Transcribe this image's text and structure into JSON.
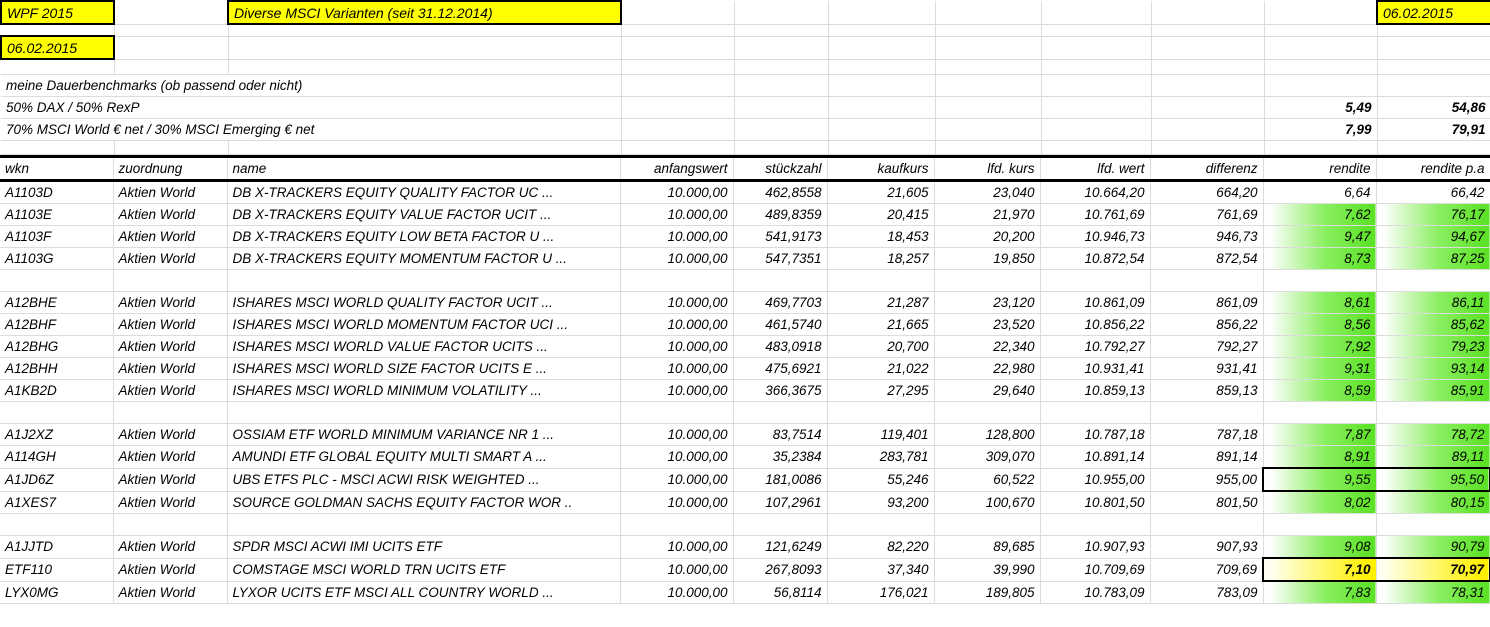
{
  "meta": {
    "report_label": "WPF 2015",
    "title": "Diverse MSCI Varianten (seit 31.12.2014)",
    "date_right": "06.02.2015",
    "date_left": "06.02.2015"
  },
  "benchmarks": {
    "heading": "meine Dauerbenchmarks (ob passend oder nicht)",
    "rows": [
      {
        "label": "50% DAX / 50% RexP",
        "rendite": "5,49",
        "rendite_pa": "54,86"
      },
      {
        "label": "70% MSCI World € net / 30% MSCI Emerging € net",
        "rendite": "7,99",
        "rendite_pa": "79,91"
      }
    ]
  },
  "table": {
    "columns": [
      "wkn",
      "zuordnung",
      "name",
      "anfangswert",
      "stückzahl",
      "kaufkurs",
      "lfd. kurs",
      "lfd. wert",
      "differenz",
      "rendite",
      "rendite p.a"
    ],
    "groups": [
      {
        "rows": [
          {
            "wkn": "A1103D",
            "zuordnung": "Aktien World",
            "name": "DB X-TRACKERS EQUITY QUALITY FACTOR UC ...",
            "anfangswert": "10.000,00",
            "stueckzahl": "462,8558",
            "kaufkurs": "21,605",
            "lfd_kurs": "23,040",
            "lfd_wert": "10.664,20",
            "differenz": "664,20",
            "rendite": "6,64",
            "rendite_pa": "66,42",
            "highlight": "none",
            "boxed": false,
            "bold": false
          },
          {
            "wkn": "A1103E",
            "zuordnung": "Aktien World",
            "name": "DB X-TRACKERS EQUITY VALUE FACTOR UCIT ...",
            "anfangswert": "10.000,00",
            "stueckzahl": "489,8359",
            "kaufkurs": "20,415",
            "lfd_kurs": "21,970",
            "lfd_wert": "10.761,69",
            "differenz": "761,69",
            "rendite": "7,62",
            "rendite_pa": "76,17",
            "highlight": "green",
            "boxed": false,
            "bold": false
          },
          {
            "wkn": "A1103F",
            "zuordnung": "Aktien World",
            "name": "DB X-TRACKERS EQUITY LOW BETA FACTOR U ...",
            "anfangswert": "10.000,00",
            "stueckzahl": "541,9173",
            "kaufkurs": "18,453",
            "lfd_kurs": "20,200",
            "lfd_wert": "10.946,73",
            "differenz": "946,73",
            "rendite": "9,47",
            "rendite_pa": "94,67",
            "highlight": "green",
            "boxed": false,
            "bold": false
          },
          {
            "wkn": "A1103G",
            "zuordnung": "Aktien World",
            "name": "DB X-TRACKERS EQUITY MOMENTUM FACTOR U ...",
            "anfangswert": "10.000,00",
            "stueckzahl": "547,7351",
            "kaufkurs": "18,257",
            "lfd_kurs": "19,850",
            "lfd_wert": "10.872,54",
            "differenz": "872,54",
            "rendite": "8,73",
            "rendite_pa": "87,25",
            "highlight": "green",
            "boxed": false,
            "bold": false
          }
        ]
      },
      {
        "rows": [
          {
            "wkn": "A12BHE",
            "zuordnung": "Aktien World",
            "name": "ISHARES MSCI WORLD QUALITY FACTOR UCIT ...",
            "anfangswert": "10.000,00",
            "stueckzahl": "469,7703",
            "kaufkurs": "21,287",
            "lfd_kurs": "23,120",
            "lfd_wert": "10.861,09",
            "differenz": "861,09",
            "rendite": "8,61",
            "rendite_pa": "86,11",
            "highlight": "green",
            "boxed": false,
            "bold": false
          },
          {
            "wkn": "A12BHF",
            "zuordnung": "Aktien World",
            "name": "ISHARES MSCI WORLD MOMENTUM FACTOR UCI ...",
            "anfangswert": "10.000,00",
            "stueckzahl": "461,5740",
            "kaufkurs": "21,665",
            "lfd_kurs": "23,520",
            "lfd_wert": "10.856,22",
            "differenz": "856,22",
            "rendite": "8,56",
            "rendite_pa": "85,62",
            "highlight": "green",
            "boxed": false,
            "bold": false
          },
          {
            "wkn": "A12BHG",
            "zuordnung": "Aktien World",
            "name": "ISHARES MSCI WORLD VALUE FACTOR UCITS ...",
            "anfangswert": "10.000,00",
            "stueckzahl": "483,0918",
            "kaufkurs": "20,700",
            "lfd_kurs": "22,340",
            "lfd_wert": "10.792,27",
            "differenz": "792,27",
            "rendite": "7,92",
            "rendite_pa": "79,23",
            "highlight": "green",
            "boxed": false,
            "bold": false
          },
          {
            "wkn": "A12BHH",
            "zuordnung": "Aktien World",
            "name": "ISHARES MSCI WORLD SIZE FACTOR UCITS E ...",
            "anfangswert": "10.000,00",
            "stueckzahl": "475,6921",
            "kaufkurs": "21,022",
            "lfd_kurs": "22,980",
            "lfd_wert": "10.931,41",
            "differenz": "931,41",
            "rendite": "9,31",
            "rendite_pa": "93,14",
            "highlight": "green",
            "boxed": false,
            "bold": false
          },
          {
            "wkn": "A1KB2D",
            "zuordnung": "Aktien World",
            "name": "ISHARES MSCI WORLD MINIMUM VOLATILITY ...",
            "anfangswert": "10.000,00",
            "stueckzahl": "366,3675",
            "kaufkurs": "27,295",
            "lfd_kurs": "29,640",
            "lfd_wert": "10.859,13",
            "differenz": "859,13",
            "rendite": "8,59",
            "rendite_pa": "85,91",
            "highlight": "green",
            "boxed": false,
            "bold": false
          }
        ]
      },
      {
        "rows": [
          {
            "wkn": "A1J2XZ",
            "zuordnung": "Aktien World",
            "name": "OSSIAM ETF WORLD MINIMUM VARIANCE NR 1 ...",
            "anfangswert": "10.000,00",
            "stueckzahl": "83,7514",
            "kaufkurs": "119,401",
            "lfd_kurs": "128,800",
            "lfd_wert": "10.787,18",
            "differenz": "787,18",
            "rendite": "7,87",
            "rendite_pa": "78,72",
            "highlight": "green",
            "boxed": false,
            "bold": false
          },
          {
            "wkn": "A114GH",
            "zuordnung": "Aktien World",
            "name": "AMUNDI ETF GLOBAL EQUITY MULTI SMART A ...",
            "anfangswert": "10.000,00",
            "stueckzahl": "35,2384",
            "kaufkurs": "283,781",
            "lfd_kurs": "309,070",
            "lfd_wert": "10.891,14",
            "differenz": "891,14",
            "rendite": "8,91",
            "rendite_pa": "89,11",
            "highlight": "green",
            "boxed": false,
            "bold": false
          },
          {
            "wkn": "A1JD6Z",
            "zuordnung": "Aktien World",
            "name": "UBS ETFS PLC - MSCI ACWI RISK WEIGHTED ...",
            "anfangswert": "10.000,00",
            "stueckzahl": "181,0086",
            "kaufkurs": "55,246",
            "lfd_kurs": "60,522",
            "lfd_wert": "10.955,00",
            "differenz": "955,00",
            "rendite": "9,55",
            "rendite_pa": "95,50",
            "highlight": "green",
            "boxed": true,
            "bold": false
          },
          {
            "wkn": "A1XES7",
            "zuordnung": "Aktien World",
            "name": "SOURCE GOLDMAN SACHS EQUITY FACTOR WOR ..",
            "anfangswert": "10.000,00",
            "stueckzahl": "107,2961",
            "kaufkurs": "93,200",
            "lfd_kurs": "100,670",
            "lfd_wert": "10.801,50",
            "differenz": "801,50",
            "rendite": "8,02",
            "rendite_pa": "80,15",
            "highlight": "green",
            "boxed": false,
            "bold": false
          }
        ]
      },
      {
        "rows": [
          {
            "wkn": "A1JJTD",
            "zuordnung": "Aktien World",
            "name": "SPDR MSCI ACWI IMI UCITS ETF",
            "anfangswert": "10.000,00",
            "stueckzahl": "121,6249",
            "kaufkurs": "82,220",
            "lfd_kurs": "89,685",
            "lfd_wert": "10.907,93",
            "differenz": "907,93",
            "rendite": "9,08",
            "rendite_pa": "90,79",
            "highlight": "green",
            "boxed": false,
            "bold": false
          },
          {
            "wkn": "ETF110",
            "zuordnung": "Aktien World",
            "name": "COMSTAGE MSCI WORLD TRN UCITS ETF",
            "anfangswert": "10.000,00",
            "stueckzahl": "267,8093",
            "kaufkurs": "37,340",
            "lfd_kurs": "39,990",
            "lfd_wert": "10.709,69",
            "differenz": "709,69",
            "rendite": "7,10",
            "rendite_pa": "70,97",
            "highlight": "yellow",
            "boxed": true,
            "bold": true
          },
          {
            "wkn": "LYX0MG",
            "zuordnung": "Aktien World",
            "name": "LYXOR UCITS ETF MSCI ALL COUNTRY WORLD ...",
            "anfangswert": "10.000,00",
            "stueckzahl": "56,8114",
            "kaufkurs": "176,021",
            "lfd_kurs": "189,805",
            "lfd_wert": "10.783,09",
            "differenz": "783,09",
            "rendite": "7,83",
            "rendite_pa": "78,31",
            "highlight": "green",
            "boxed": false,
            "bold": false
          }
        ]
      }
    ]
  },
  "colors": {
    "highlight_yellow": "#ffff00",
    "gradient_green_end": "#5ee229",
    "gradient_yellow_end": "#ffef00",
    "grid_line": "#dcdcdc",
    "border_black": "#000000"
  }
}
